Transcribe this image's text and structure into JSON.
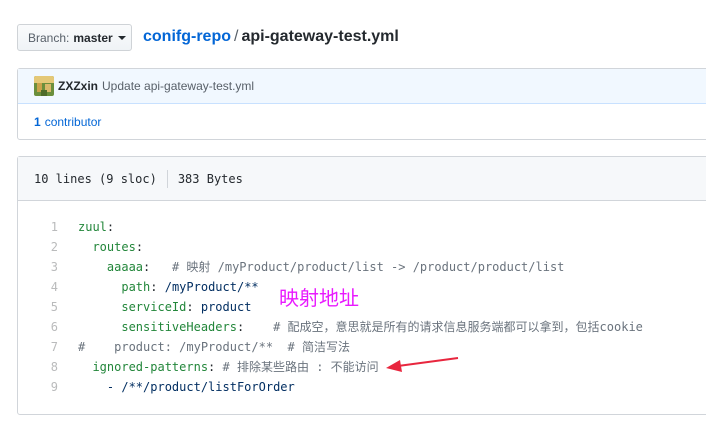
{
  "branch": {
    "label": "Branch:",
    "name": "master"
  },
  "breadcrumb": {
    "repo": "conifg-repo",
    "separator": "/",
    "file": "api-gateway-test.yml"
  },
  "commit": {
    "author": "ZXZxin",
    "message": "Update api-gateway-test.yml",
    "contributors_count": "1",
    "contributors_label": "contributor"
  },
  "file_info": {
    "lines": "10 lines (9 sloc)",
    "size": "383 Bytes"
  },
  "code": [
    {
      "num": "1",
      "indent": "",
      "key": "zuul",
      "colon": ":",
      "value": "",
      "comment": ""
    },
    {
      "num": "2",
      "indent": "  ",
      "key": "routes",
      "colon": ":",
      "value": "",
      "comment": ""
    },
    {
      "num": "3",
      "indent": "    ",
      "key": "aaaaa",
      "colon": ":",
      "value": "   ",
      "comment": "# 映射 /myProduct/product/list -> /product/product/list"
    },
    {
      "num": "4",
      "indent": "      ",
      "key": "path",
      "colon": ":",
      "value": " /myProduct/**",
      "comment": ""
    },
    {
      "num": "5",
      "indent": "      ",
      "key": "serviceId",
      "colon": ":",
      "value": " product",
      "comment": ""
    },
    {
      "num": "6",
      "indent": "      ",
      "key": "sensitiveHeaders",
      "colon": ":",
      "value": "    ",
      "comment": "# 配成空，意思就是所有的请求信息服务端都可以拿到，包括cookie"
    },
    {
      "num": "7",
      "indent": "",
      "key": "",
      "colon": "",
      "value": "",
      "comment": "#    product: /myProduct/**  # 简洁写法"
    },
    {
      "num": "8",
      "indent": "  ",
      "key": "ignored-patterns",
      "colon": ":",
      "value": " ",
      "comment": "# 排除某些路由 : 不能访问"
    },
    {
      "num": "9",
      "indent": "    ",
      "key": "",
      "colon": "",
      "value": "- /**/product/listForOrder",
      "comment": ""
    }
  ],
  "annotation": {
    "text": "映射地址",
    "color": "#e91aff"
  },
  "arrow": {
    "color": "#e8263e"
  }
}
